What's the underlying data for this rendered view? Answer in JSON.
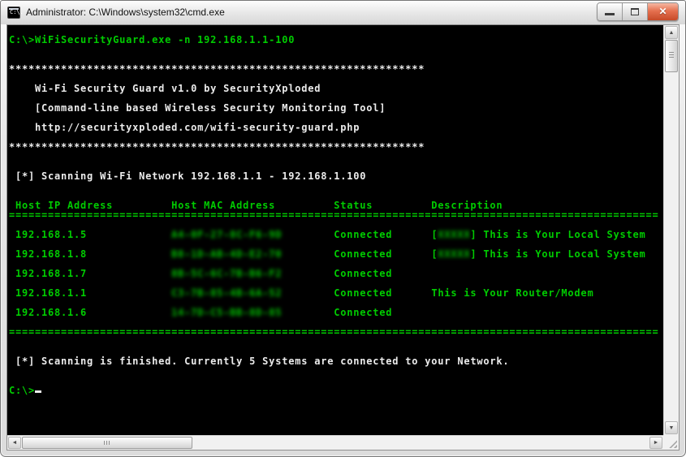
{
  "window": {
    "title": "Administrator: C:\\Windows\\system32\\cmd.exe",
    "icon_label": "C:\\.",
    "controls": {
      "minimize": "minimize",
      "maximize": "maximize",
      "close_glyph": "✕"
    }
  },
  "icons": {
    "scroll_up": "▲",
    "scroll_down": "▼",
    "scroll_left": "◄",
    "scroll_right": "►"
  },
  "colors": {
    "console_background": "#000000",
    "console_green": "#00cc00",
    "console_white": "#ececec",
    "close_button_red": "#c64a28"
  },
  "console": {
    "lines": [
      {
        "seg": [
          {
            "c": "g",
            "t": "C:\\>WiFiSecurityGuard.exe -n 192.168.1.1-100"
          }
        ]
      },
      {
        "seg": []
      },
      {
        "seg": []
      },
      {
        "seg": [
          {
            "c": "w",
            "t": "****************************************************************"
          }
        ]
      },
      {
        "seg": []
      },
      {
        "seg": [
          {
            "c": "w",
            "t": "    Wi-Fi Security Guard v1.0 by SecurityXploded"
          }
        ]
      },
      {
        "seg": []
      },
      {
        "seg": [
          {
            "c": "w",
            "t": "    [Command-line based Wireless Security Monitoring Tool]"
          }
        ]
      },
      {
        "seg": []
      },
      {
        "seg": [
          {
            "c": "w",
            "t": "    http://securityxploded.com/wifi-security-guard.php"
          }
        ]
      },
      {
        "seg": []
      },
      {
        "seg": [
          {
            "c": "w",
            "t": "****************************************************************"
          }
        ]
      },
      {
        "seg": []
      },
      {
        "seg": []
      },
      {
        "seg": [
          {
            "c": "w",
            "t": " [*] Scanning Wi-Fi Network 192.168.1.1 - 192.168.1.100"
          }
        ]
      },
      {
        "seg": []
      },
      {
        "seg": []
      },
      {
        "seg": [
          {
            "c": "g",
            "t": " Host IP Address         Host MAC Address         Status         Description"
          }
        ]
      },
      {
        "seg": [
          {
            "c": "g",
            "t": "===================================================================================================="
          }
        ]
      },
      {
        "seg": []
      },
      {
        "seg": [
          {
            "c": "g",
            "t": " 192.168.1.5             "
          },
          {
            "c": "g",
            "b": true,
            "t": "A4-0F-27-8C-F6-9D"
          },
          {
            "c": "g",
            "t": "        Connected      "
          },
          {
            "c": "g",
            "t": "["
          },
          {
            "c": "g",
            "b": true,
            "t": "XXXXX"
          },
          {
            "c": "g",
            "t": "] This is Your Local System"
          }
        ]
      },
      {
        "seg": []
      },
      {
        "seg": [
          {
            "c": "g",
            "t": " 192.168.1.8             "
          },
          {
            "c": "g",
            "b": true,
            "t": "B8-1D-AB-4D-E2-70"
          },
          {
            "c": "g",
            "t": "        Connected      "
          },
          {
            "c": "g",
            "t": "["
          },
          {
            "c": "g",
            "b": true,
            "t": "XXXXX"
          },
          {
            "c": "g",
            "t": "] This is Your Local System"
          }
        ]
      },
      {
        "seg": []
      },
      {
        "seg": [
          {
            "c": "g",
            "t": " 192.168.1.7             "
          },
          {
            "c": "g",
            "b": true,
            "t": "8B-5C-6C-7B-B6-F2"
          },
          {
            "c": "g",
            "t": "        Connected"
          }
        ]
      },
      {
        "seg": []
      },
      {
        "seg": [
          {
            "c": "g",
            "t": " 192.168.1.1             "
          },
          {
            "c": "g",
            "b": true,
            "t": "C3-7B-85-4B-6A-52"
          },
          {
            "c": "g",
            "t": "        Connected      "
          },
          {
            "c": "g",
            "t": "This is Your Router/Modem"
          }
        ]
      },
      {
        "seg": []
      },
      {
        "seg": [
          {
            "c": "g",
            "t": " 192.168.1.6             "
          },
          {
            "c": "g",
            "b": true,
            "t": "14-7D-C5-BB-8D-85"
          },
          {
            "c": "g",
            "t": "        Connected"
          }
        ]
      },
      {
        "seg": []
      },
      {
        "seg": [
          {
            "c": "g",
            "t": "===================================================================================================="
          }
        ]
      },
      {
        "seg": []
      },
      {
        "seg": []
      },
      {
        "seg": [
          {
            "c": "w",
            "t": " [*] Scanning is finished. Currently 5 Systems are connected to your Network."
          }
        ]
      },
      {
        "seg": []
      },
      {
        "seg": []
      },
      {
        "seg": [
          {
            "c": "g",
            "t": "C:\\>"
          },
          {
            "cursor": true
          }
        ]
      }
    ]
  }
}
